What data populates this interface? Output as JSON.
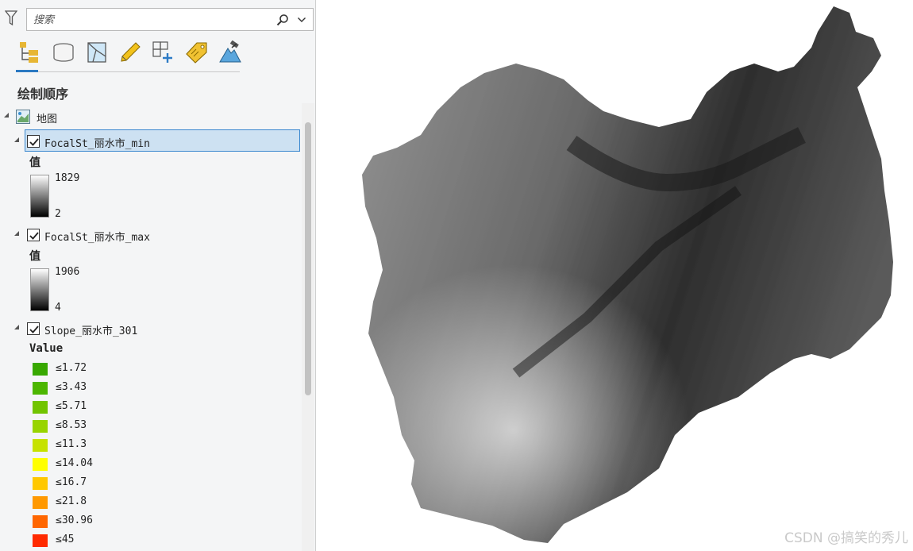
{
  "search": {
    "placeholder": "搜索"
  },
  "toolbar": {
    "icons": [
      "list-by-drawing-order-icon",
      "list-by-source-icon",
      "list-by-selection-icon",
      "list-by-editing-icon",
      "list-by-snapping-icon",
      "list-by-labeling-icon",
      "list-by-perspective-icon"
    ]
  },
  "contents": {
    "section_title": "绘制顺序",
    "map_name": "地图",
    "layers": [
      {
        "name": "FocalSt_丽水市_min",
        "checked": true,
        "selected": true,
        "legend_title": "值",
        "ramp_max": "1829",
        "ramp_min": "2"
      },
      {
        "name": "FocalSt_丽水市_max",
        "checked": true,
        "selected": false,
        "legend_title": "值",
        "ramp_max": "1906",
        "ramp_min": "4"
      },
      {
        "name": "Slope_丽水市_301",
        "checked": true,
        "selected": false,
        "legend_title": "Value",
        "classes": [
          {
            "label": "≤1.72",
            "color": "#38a800"
          },
          {
            "label": "≤3.43",
            "color": "#4cb600"
          },
          {
            "label": "≤5.71",
            "color": "#71c400"
          },
          {
            "label": "≤8.53",
            "color": "#98d400"
          },
          {
            "label": "≤11.3",
            "color": "#c6e200"
          },
          {
            "label": "≤14.04",
            "color": "#ffff00"
          },
          {
            "label": "≤16.7",
            "color": "#ffc800"
          },
          {
            "label": "≤21.8",
            "color": "#ff9900"
          },
          {
            "label": "≤30.96",
            "color": "#ff6600"
          },
          {
            "label": "≤45",
            "color": "#ff2a00"
          }
        ]
      }
    ]
  },
  "map": {
    "description_fill": "#7a7a7a"
  },
  "watermark": "CSDN @搞笑的秀儿"
}
